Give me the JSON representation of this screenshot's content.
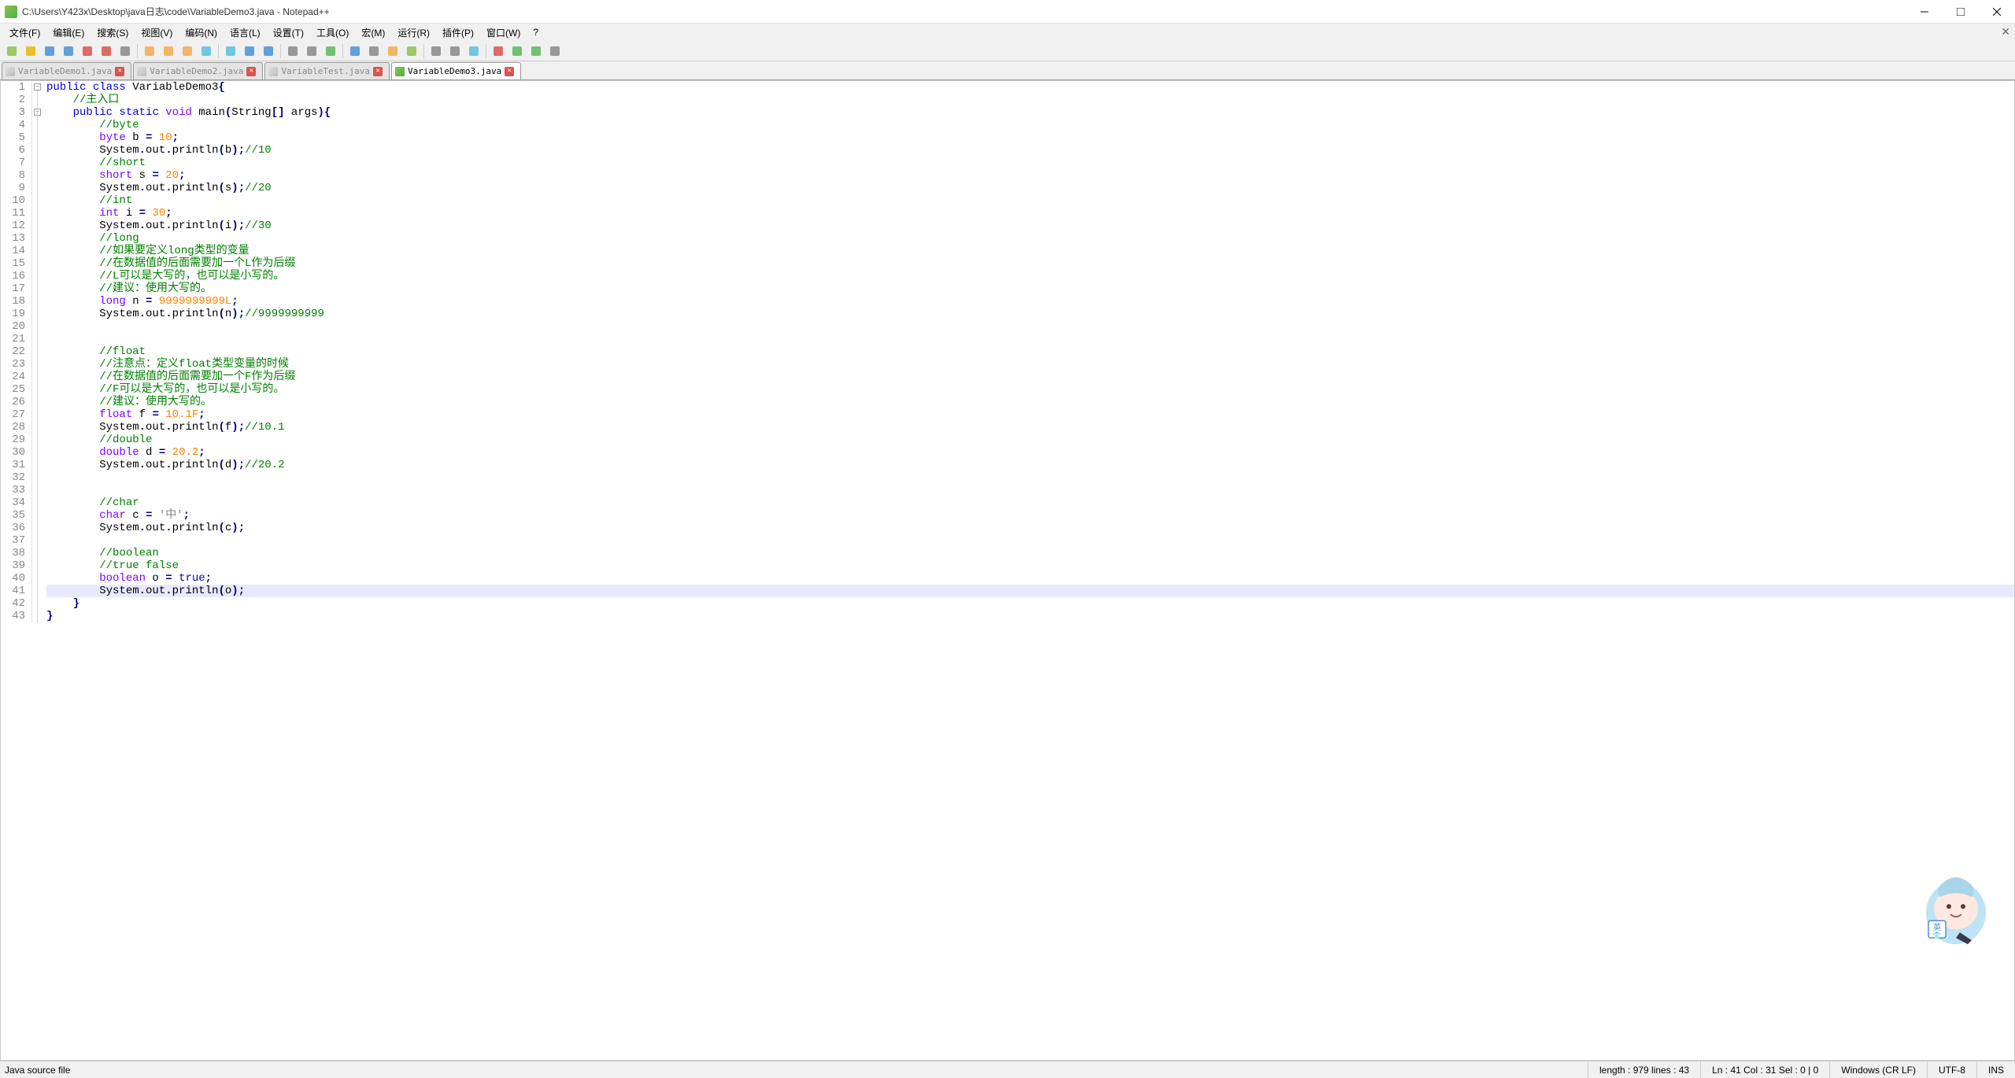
{
  "title": "C:\\Users\\Y423x\\Desktop\\java日志\\code\\VariableDemo3.java - Notepad++",
  "menu": [
    "文件(F)",
    "编辑(E)",
    "搜索(S)",
    "视图(V)",
    "编码(N)",
    "语言(L)",
    "设置(T)",
    "工具(O)",
    "宏(M)",
    "运行(R)",
    "插件(P)",
    "窗口(W)",
    "?"
  ],
  "tabs": [
    {
      "label": "VariableDemo1.java",
      "active": false
    },
    {
      "label": "VariableDemo2.java",
      "active": false
    },
    {
      "label": "VariableTest.java",
      "active": false
    },
    {
      "label": "VariableDemo3.java",
      "active": true
    }
  ],
  "code": [
    {
      "n": 1,
      "fold": "box",
      "tokens": [
        [
          "kw",
          "public"
        ],
        [
          "id",
          " "
        ],
        [
          "kw",
          "class"
        ],
        [
          "id",
          " VariableDemo3"
        ],
        [
          "pun",
          "{"
        ]
      ]
    },
    {
      "n": 2,
      "tokens": [
        [
          "id",
          "    "
        ],
        [
          "cmt",
          "//主入口"
        ]
      ]
    },
    {
      "n": 3,
      "fold": "box",
      "tokens": [
        [
          "id",
          "    "
        ],
        [
          "kw",
          "public"
        ],
        [
          "id",
          " "
        ],
        [
          "kw",
          "static"
        ],
        [
          "id",
          " "
        ],
        [
          "type",
          "void"
        ],
        [
          "id",
          " main"
        ],
        [
          "pun",
          "("
        ],
        [
          "id",
          "String"
        ],
        [
          "pun",
          "[]"
        ],
        [
          "id",
          " args"
        ],
        [
          "pun",
          ")"
        ],
        [
          "pun",
          "{"
        ]
      ]
    },
    {
      "n": 4,
      "tokens": [
        [
          "id",
          "        "
        ],
        [
          "cmt",
          "//byte"
        ]
      ]
    },
    {
      "n": 5,
      "tokens": [
        [
          "id",
          "        "
        ],
        [
          "type",
          "byte"
        ],
        [
          "id",
          " b "
        ],
        [
          "pun",
          "="
        ],
        [
          "id",
          " "
        ],
        [
          "num",
          "10"
        ],
        [
          "pun",
          ";"
        ]
      ]
    },
    {
      "n": 6,
      "tokens": [
        [
          "id",
          "        System"
        ],
        [
          "pun",
          "."
        ],
        [
          "id",
          "out"
        ],
        [
          "pun",
          "."
        ],
        [
          "id",
          "println"
        ],
        [
          "pun",
          "("
        ],
        [
          "id",
          "b"
        ],
        [
          "pun",
          ")"
        ],
        [
          "pun",
          ";"
        ],
        [
          "cmt",
          "//10"
        ]
      ]
    },
    {
      "n": 7,
      "tokens": [
        [
          "id",
          "        "
        ],
        [
          "cmt",
          "//short"
        ]
      ]
    },
    {
      "n": 8,
      "tokens": [
        [
          "id",
          "        "
        ],
        [
          "type",
          "short"
        ],
        [
          "id",
          " s "
        ],
        [
          "pun",
          "="
        ],
        [
          "id",
          " "
        ],
        [
          "num",
          "20"
        ],
        [
          "pun",
          ";"
        ]
      ]
    },
    {
      "n": 9,
      "tokens": [
        [
          "id",
          "        System"
        ],
        [
          "pun",
          "."
        ],
        [
          "id",
          "out"
        ],
        [
          "pun",
          "."
        ],
        [
          "id",
          "println"
        ],
        [
          "pun",
          "("
        ],
        [
          "id",
          "s"
        ],
        [
          "pun",
          ")"
        ],
        [
          "pun",
          ";"
        ],
        [
          "cmt",
          "//20"
        ]
      ]
    },
    {
      "n": 10,
      "tokens": [
        [
          "id",
          "        "
        ],
        [
          "cmt",
          "//int"
        ]
      ]
    },
    {
      "n": 11,
      "tokens": [
        [
          "id",
          "        "
        ],
        [
          "type",
          "int"
        ],
        [
          "id",
          " i "
        ],
        [
          "pun",
          "="
        ],
        [
          "id",
          " "
        ],
        [
          "num",
          "30"
        ],
        [
          "pun",
          ";"
        ]
      ]
    },
    {
      "n": 12,
      "tokens": [
        [
          "id",
          "        System"
        ],
        [
          "pun",
          "."
        ],
        [
          "id",
          "out"
        ],
        [
          "pun",
          "."
        ],
        [
          "id",
          "println"
        ],
        [
          "pun",
          "("
        ],
        [
          "id",
          "i"
        ],
        [
          "pun",
          ")"
        ],
        [
          "pun",
          ";"
        ],
        [
          "cmt",
          "//30"
        ]
      ]
    },
    {
      "n": 13,
      "tokens": [
        [
          "id",
          "        "
        ],
        [
          "cmt",
          "//long"
        ]
      ]
    },
    {
      "n": 14,
      "tokens": [
        [
          "id",
          "        "
        ],
        [
          "cmt",
          "//如果要定义long类型的变量"
        ]
      ]
    },
    {
      "n": 15,
      "tokens": [
        [
          "id",
          "        "
        ],
        [
          "cmt",
          "//在数据值的后面需要加一个L作为后缀"
        ]
      ]
    },
    {
      "n": 16,
      "tokens": [
        [
          "id",
          "        "
        ],
        [
          "cmt",
          "//L可以是大写的，也可以是小写的。"
        ]
      ]
    },
    {
      "n": 17,
      "tokens": [
        [
          "id",
          "        "
        ],
        [
          "cmt",
          "//建议：使用大写的。"
        ]
      ]
    },
    {
      "n": 18,
      "tokens": [
        [
          "id",
          "        "
        ],
        [
          "type",
          "long"
        ],
        [
          "id",
          " n "
        ],
        [
          "pun",
          "="
        ],
        [
          "id",
          " "
        ],
        [
          "num",
          "9999999999L"
        ],
        [
          "pun",
          ";"
        ]
      ]
    },
    {
      "n": 19,
      "tokens": [
        [
          "id",
          "        System"
        ],
        [
          "pun",
          "."
        ],
        [
          "id",
          "out"
        ],
        [
          "pun",
          "."
        ],
        [
          "id",
          "println"
        ],
        [
          "pun",
          "("
        ],
        [
          "id",
          "n"
        ],
        [
          "pun",
          ")"
        ],
        [
          "pun",
          ";"
        ],
        [
          "cmt",
          "//9999999999"
        ]
      ]
    },
    {
      "n": 20,
      "tokens": [
        [
          "id",
          ""
        ]
      ]
    },
    {
      "n": 21,
      "tokens": [
        [
          "id",
          ""
        ]
      ]
    },
    {
      "n": 22,
      "tokens": [
        [
          "id",
          "        "
        ],
        [
          "cmt",
          "//float"
        ]
      ]
    },
    {
      "n": 23,
      "tokens": [
        [
          "id",
          "        "
        ],
        [
          "cmt",
          "//注意点：定义float类型变量的时候"
        ]
      ]
    },
    {
      "n": 24,
      "tokens": [
        [
          "id",
          "        "
        ],
        [
          "cmt",
          "//在数据值的后面需要加一个F作为后缀"
        ]
      ]
    },
    {
      "n": 25,
      "tokens": [
        [
          "id",
          "        "
        ],
        [
          "cmt",
          "//F可以是大写的，也可以是小写的。"
        ]
      ]
    },
    {
      "n": 26,
      "tokens": [
        [
          "id",
          "        "
        ],
        [
          "cmt",
          "//建议：使用大写的。"
        ]
      ]
    },
    {
      "n": 27,
      "tokens": [
        [
          "id",
          "        "
        ],
        [
          "type",
          "float"
        ],
        [
          "id",
          " f "
        ],
        [
          "pun",
          "="
        ],
        [
          "id",
          " "
        ],
        [
          "num",
          "10.1F"
        ],
        [
          "pun",
          ";"
        ]
      ]
    },
    {
      "n": 28,
      "tokens": [
        [
          "id",
          "        System"
        ],
        [
          "pun",
          "."
        ],
        [
          "id",
          "out"
        ],
        [
          "pun",
          "."
        ],
        [
          "id",
          "println"
        ],
        [
          "pun",
          "("
        ],
        [
          "id",
          "f"
        ],
        [
          "pun",
          ")"
        ],
        [
          "pun",
          ";"
        ],
        [
          "cmt",
          "//10.1"
        ]
      ]
    },
    {
      "n": 29,
      "tokens": [
        [
          "id",
          "        "
        ],
        [
          "cmt",
          "//double"
        ]
      ]
    },
    {
      "n": 30,
      "tokens": [
        [
          "id",
          "        "
        ],
        [
          "type",
          "double"
        ],
        [
          "id",
          " d "
        ],
        [
          "pun",
          "="
        ],
        [
          "id",
          " "
        ],
        [
          "num",
          "20.2"
        ],
        [
          "pun",
          ";"
        ]
      ]
    },
    {
      "n": 31,
      "tokens": [
        [
          "id",
          "        System"
        ],
        [
          "pun",
          "."
        ],
        [
          "id",
          "out"
        ],
        [
          "pun",
          "."
        ],
        [
          "id",
          "println"
        ],
        [
          "pun",
          "("
        ],
        [
          "id",
          "d"
        ],
        [
          "pun",
          ")"
        ],
        [
          "pun",
          ";"
        ],
        [
          "cmt",
          "//20.2"
        ]
      ]
    },
    {
      "n": 32,
      "tokens": [
        [
          "id",
          ""
        ]
      ]
    },
    {
      "n": 33,
      "tokens": [
        [
          "id",
          ""
        ]
      ]
    },
    {
      "n": 34,
      "tokens": [
        [
          "id",
          "        "
        ],
        [
          "cmt",
          "//char"
        ]
      ]
    },
    {
      "n": 35,
      "tokens": [
        [
          "id",
          "        "
        ],
        [
          "type",
          "char"
        ],
        [
          "id",
          " c "
        ],
        [
          "pun",
          "="
        ],
        [
          "id",
          " "
        ],
        [
          "str",
          "'中'"
        ],
        [
          "pun",
          ";"
        ]
      ]
    },
    {
      "n": 36,
      "tokens": [
        [
          "id",
          "        System"
        ],
        [
          "pun",
          "."
        ],
        [
          "id",
          "out"
        ],
        [
          "pun",
          "."
        ],
        [
          "id",
          "println"
        ],
        [
          "pun",
          "("
        ],
        [
          "id",
          "c"
        ],
        [
          "pun",
          ")"
        ],
        [
          "pun",
          ";"
        ]
      ]
    },
    {
      "n": 37,
      "tokens": [
        [
          "id",
          ""
        ]
      ]
    },
    {
      "n": 38,
      "tokens": [
        [
          "id",
          "        "
        ],
        [
          "cmt",
          "//boolean"
        ]
      ]
    },
    {
      "n": 39,
      "tokens": [
        [
          "id",
          "        "
        ],
        [
          "cmt",
          "//true false"
        ]
      ]
    },
    {
      "n": 40,
      "tokens": [
        [
          "id",
          "        "
        ],
        [
          "type",
          "boolean"
        ],
        [
          "id",
          " o "
        ],
        [
          "pun",
          "="
        ],
        [
          "id",
          " "
        ],
        [
          "kw",
          "true"
        ],
        [
          "pun",
          ";"
        ]
      ]
    },
    {
      "n": 41,
      "current": true,
      "tokens": [
        [
          "id",
          "        System"
        ],
        [
          "pun",
          "."
        ],
        [
          "id",
          "out"
        ],
        [
          "pun",
          "."
        ],
        [
          "id",
          "println"
        ],
        [
          "pun",
          "("
        ],
        [
          "id",
          "o"
        ],
        [
          "pun",
          ")"
        ],
        [
          "pun",
          ";"
        ]
      ]
    },
    {
      "n": 42,
      "tokens": [
        [
          "id",
          "    "
        ],
        [
          "pun",
          "}"
        ]
      ]
    },
    {
      "n": 43,
      "tokens": [
        [
          "pun",
          "}"
        ]
      ]
    }
  ],
  "status": {
    "left": "Java source file",
    "length": "length : 979    lines : 43",
    "pos": "Ln : 41    Col : 31    Sel : 0 | 0",
    "eol": "Windows (CR LF)",
    "enc": "UTF-8",
    "mode": "INS"
  },
  "toolbar_icons": [
    "new",
    "open",
    "save",
    "saveall",
    "close",
    "closeall",
    "print",
    "cut",
    "copy",
    "paste",
    "undo",
    "redo",
    "find",
    "replace",
    "zoomin",
    "zoomout",
    "sync",
    "wordwrap",
    "showall",
    "indent",
    "folding",
    "comment",
    "uncomment",
    "function",
    "record",
    "play",
    "playall",
    "stop"
  ]
}
